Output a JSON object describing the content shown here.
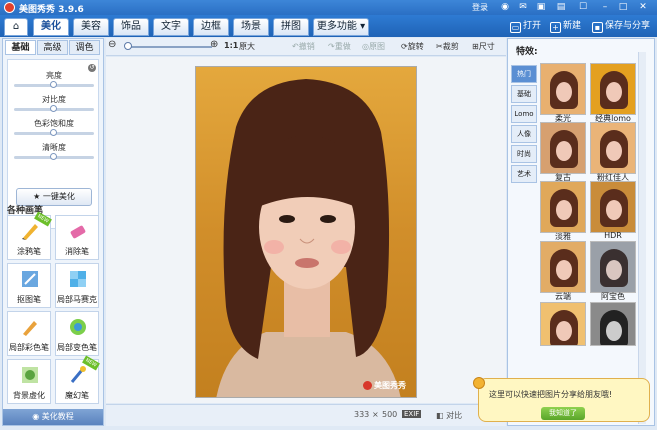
{
  "app": {
    "title": "美图秀秀 3.9.6",
    "login": "登录"
  },
  "tabs": [
    "美化",
    "美容",
    "饰品",
    "文字",
    "边框",
    "场景",
    "拼图",
    "更多功能 ▾"
  ],
  "top_tools": {
    "open": "打开",
    "new": "新建",
    "save": "保存与分享"
  },
  "left_tabs": [
    "基础",
    "高级",
    "调色"
  ],
  "adjust": {
    "items": [
      "亮度",
      "对比度",
      "色彩饱和度",
      "清晰度"
    ],
    "one_click": "一键美化"
  },
  "pens": {
    "title": "各种画笔",
    "items": [
      "涂鸦笔",
      "消除笔",
      "抠图笔",
      "局部马赛克",
      "局部彩色笔",
      "局部变色笔",
      "背景虚化",
      "魔幻笔"
    ],
    "tutorial": "美化教程"
  },
  "toolbar": {
    "fit": "1:1",
    "original": "原大",
    "rotate_left": "撤销",
    "redo": "重做",
    "original_img": "原图",
    "rotate": "旋转",
    "crop": "裁剪",
    "size": "尺寸"
  },
  "status": {
    "width": "333",
    "x": "×",
    "height": "500",
    "exif": "EXIF",
    "compare": "对比"
  },
  "watermark": "美图秀秀",
  "effects": {
    "title": "特效:",
    "tabs": [
      "热门",
      "基础",
      "Lomo",
      "人像",
      "时尚",
      "艺术"
    ],
    "items": [
      "柔光",
      "经典lomo",
      "复古",
      "粉红佳人",
      "淡雅",
      "HDR",
      "云端",
      "阿宝色"
    ]
  },
  "tip": {
    "text": "这里可以快速把图片分享给朋友哦!",
    "button": "我知道了"
  }
}
